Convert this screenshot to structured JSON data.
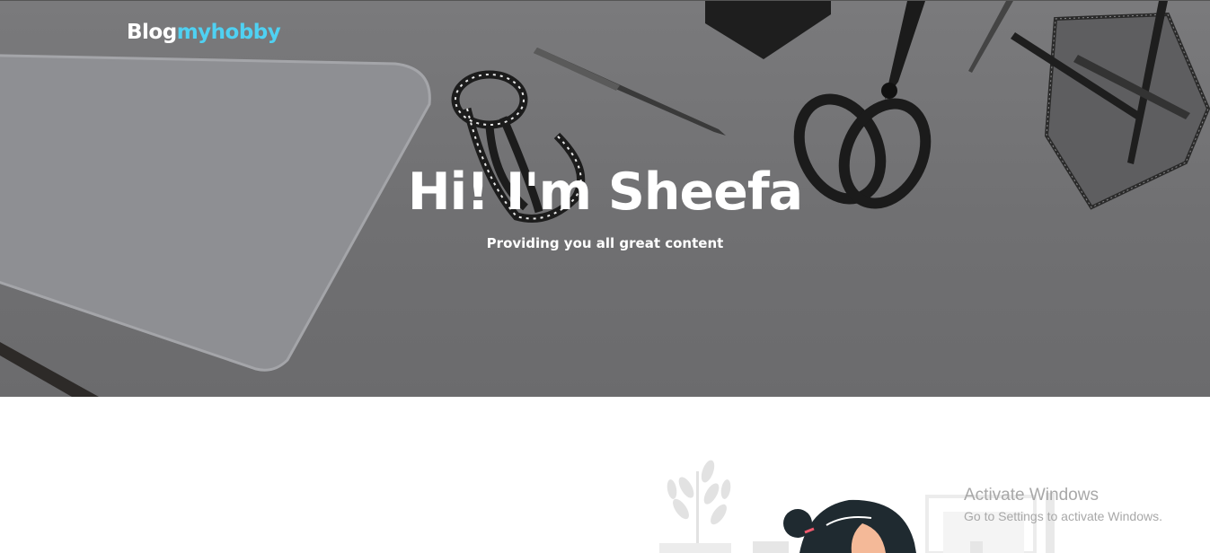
{
  "header": {
    "logo_primary": "Blog",
    "logo_accent": "myhobby"
  },
  "hero": {
    "title": "Hi! I'm Sheefa",
    "subtitle": "Providing you all great content"
  },
  "colors": {
    "accent": "#4fd1f2",
    "hero_background": "#717173",
    "text_on_hero": "#ffffff"
  },
  "system_overlay": {
    "title": "Activate Windows",
    "subtitle": "Go to Settings to activate Windows."
  }
}
